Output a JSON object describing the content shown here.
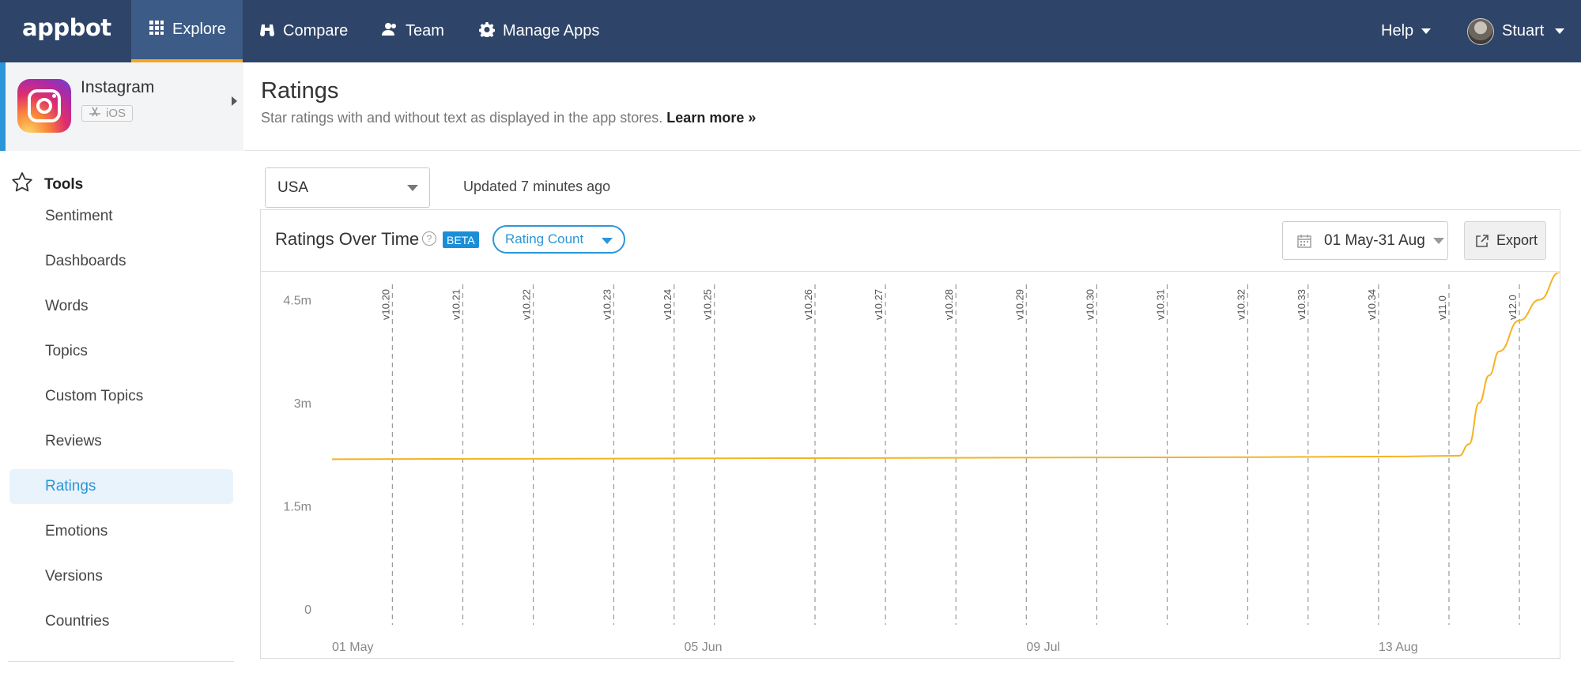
{
  "nav": {
    "logo": "appbot",
    "items": [
      {
        "label": "Explore",
        "icon": "grid-icon"
      },
      {
        "label": "Compare",
        "icon": "binoculars-icon"
      },
      {
        "label": "Team",
        "icon": "team-icon"
      },
      {
        "label": "Manage Apps",
        "icon": "gear-icon"
      }
    ],
    "help": "Help",
    "user": "Stuart"
  },
  "app": {
    "name": "Instagram",
    "platform": "iOS"
  },
  "sidebar": {
    "section_title": "Tools",
    "items": [
      {
        "label": "Sentiment"
      },
      {
        "label": "Dashboards"
      },
      {
        "label": "Words"
      },
      {
        "label": "Topics"
      },
      {
        "label": "Custom Topics"
      },
      {
        "label": "Reviews"
      },
      {
        "label": "Ratings",
        "active": true
      },
      {
        "label": "Emotions"
      },
      {
        "label": "Versions"
      },
      {
        "label": "Countries"
      }
    ]
  },
  "page": {
    "title": "Ratings",
    "subtitle": "Star ratings with and without text as displayed in the app stores.",
    "learn_more": "Learn more »"
  },
  "filters": {
    "country": "USA",
    "updated": "Updated 7 minutes ago"
  },
  "panel": {
    "title": "Ratings Over Time",
    "help": "?",
    "badge": "BETA",
    "metric": "Rating Count",
    "date_range": "01 May-31 Aug",
    "export": "Export"
  },
  "colors": {
    "nav_bg": "#2e4468",
    "accent": "#2a96d8",
    "active_tab_underline": "#f5a623",
    "series_line": "#f5b324"
  },
  "chart_data": {
    "type": "line",
    "x_range": [
      "2018-05-01",
      "2018-08-31"
    ],
    "x_ticks": [
      "01 May",
      "05 Jun",
      "09 Jul",
      "13 Aug"
    ],
    "y_ticks": [
      "0",
      "1.5m",
      "3m",
      "4.5m"
    ],
    "ylim": [
      0,
      4.5
    ],
    "y_unit": "millions",
    "series": [
      {
        "points": [
          {
            "x": "2018-05-01",
            "y": 2.18
          },
          {
            "x": "2018-05-15",
            "y": 2.185
          },
          {
            "x": "2018-06-01",
            "y": 2.19
          },
          {
            "x": "2018-06-15",
            "y": 2.195
          },
          {
            "x": "2018-07-01",
            "y": 2.2
          },
          {
            "x": "2018-07-15",
            "y": 2.205
          },
          {
            "x": "2018-08-01",
            "y": 2.21
          },
          {
            "x": "2018-08-15",
            "y": 2.22
          },
          {
            "x": "2018-08-21",
            "y": 2.23
          },
          {
            "x": "2018-08-22",
            "y": 2.4
          },
          {
            "x": "2018-08-23",
            "y": 3.0
          },
          {
            "x": "2018-08-24",
            "y": 3.4
          },
          {
            "x": "2018-08-25",
            "y": 3.75
          },
          {
            "x": "2018-08-27",
            "y": 4.2
          },
          {
            "x": "2018-08-29",
            "y": 4.5
          },
          {
            "x": "2018-08-31",
            "y": 4.9
          }
        ]
      }
    ],
    "versions": [
      {
        "label": "v10.20",
        "date": "2018-05-07"
      },
      {
        "label": "v10.21",
        "date": "2018-05-14"
      },
      {
        "label": "v10.22",
        "date": "2018-05-21"
      },
      {
        "label": "v10.23",
        "date": "2018-05-29"
      },
      {
        "label": "v10.24",
        "date": "2018-06-04"
      },
      {
        "label": "v10.25",
        "date": "2018-06-08"
      },
      {
        "label": "v10.26",
        "date": "2018-06-18"
      },
      {
        "label": "v10.27",
        "date": "2018-06-25"
      },
      {
        "label": "v10.28",
        "date": "2018-07-02"
      },
      {
        "label": "v10.29",
        "date": "2018-07-09"
      },
      {
        "label": "v10.30",
        "date": "2018-07-16"
      },
      {
        "label": "v10.31",
        "date": "2018-07-23"
      },
      {
        "label": "v10.32",
        "date": "2018-07-31"
      },
      {
        "label": "v10.33",
        "date": "2018-08-06"
      },
      {
        "label": "v10.34",
        "date": "2018-08-13"
      },
      {
        "label": "v11.0",
        "date": "2018-08-20"
      },
      {
        "label": "v12.0",
        "date": "2018-08-27"
      }
    ],
    "grid": false,
    "legend": "none"
  }
}
